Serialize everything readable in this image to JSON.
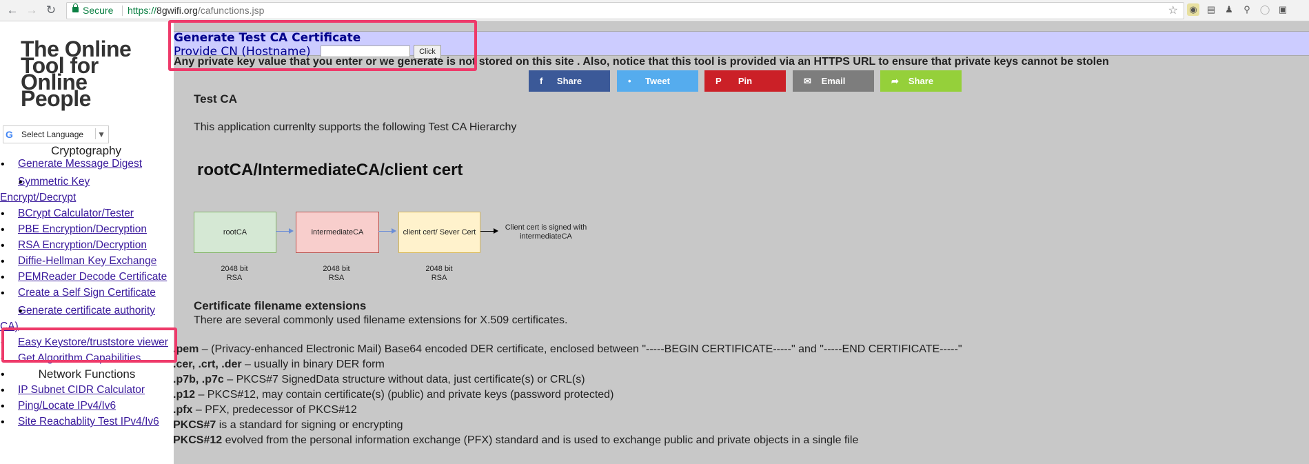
{
  "browser": {
    "secure_label": "Secure",
    "url_protocol": "https://",
    "url_host": "8gwifi.org",
    "url_path": "/cafunctions.jsp"
  },
  "sidebar": {
    "logo_lines": [
      "The Online",
      "Tool for",
      "Online",
      "People"
    ],
    "translate_label": "Select Language",
    "section_crypto": "Cryptography",
    "crypto_items": [
      "Generate Message Digest",
      "Symmetric Key",
      "Encrypt/Decrypt",
      "BCrypt Calculator/Tester",
      "PBE Encryption/Decryption",
      "RSA Encryption/Decryption",
      "Diffie-Hellman Key Exchange",
      "PEMReader Decode Certificate",
      "Create a Self Sign Certificate",
      "Generate certificate authority",
      "CA)",
      "Easy Keystore/truststore viewer",
      "Get Algorithm Capabilities"
    ],
    "section_network": "Network Functions",
    "network_items": [
      "IP Subnet CIDR Calculator",
      "Ping/Locate IPv4/Iv6",
      "Site Reachablity Test IPv4/Iv6"
    ]
  },
  "form": {
    "title": "Generate Test CA Certificate",
    "cn_label": "Provide CN (Hostname)",
    "cn_value": "",
    "click_label": "Click"
  },
  "warning": "Any private key value that you enter or we generate is not stored on this site . Also, notice that this tool is provided via an HTTPS URL to ensure that private keys cannot be stolen",
  "share_buttons": [
    {
      "label": "Share",
      "icon": "f",
      "color": "#3b5998"
    },
    {
      "label": "Tweet",
      "icon": "•",
      "color": "#55acee"
    },
    {
      "label": "Pin",
      "icon": "P",
      "color": "#cb2027"
    },
    {
      "label": "Email",
      "icon": "✉",
      "color": "#7d7d7d"
    },
    {
      "label": "Share",
      "icon": "➦",
      "color": "#95d03a"
    }
  ],
  "content": {
    "test_ca_heading": "Test CA",
    "support_text": "This application currenlty supports the following Test CA Hierarchy",
    "hierarchy_title": "rootCA/IntermediateCA/client cert",
    "diagram": {
      "boxes": [
        "rootCA",
        "intermediateCA",
        "client cert/ Sever Cert"
      ],
      "note_line1": "Client cert is signed with",
      "note_line2": "intermediateCA",
      "key_line1": "2048 bit",
      "key_line2": "RSA"
    },
    "ext_heading": "Certificate filename extensions",
    "ext_intro": "There are several commonly used filename extensions for X.509 certificates.",
    "extensions": [
      {
        "term": ".pem",
        "desc": " – (Privacy-enhanced Electronic Mail) Base64 encoded DER certificate, enclosed between \"-----BEGIN CERTIFICATE-----\" and \"-----END CERTIFICATE-----\""
      },
      {
        "term": ".cer, .crt, .der",
        "desc": " – usually in binary DER form"
      },
      {
        "term": ".p7b, .p7c",
        "desc": " – PKCS#7 SignedData structure without data, just certificate(s) or CRL(s)"
      },
      {
        "term": ".p12",
        "desc": " – PKCS#12, may contain certificate(s) (public) and private keys (password protected)"
      },
      {
        "term": ".pfx",
        "desc": " – PFX, predecessor of PKCS#12"
      },
      {
        "term": "PKCS#7",
        "desc": " is a standard for signing or encrypting"
      },
      {
        "term": "PKCS#12",
        "desc": " evolved from the personal information exchange (PFX) standard and is used to exchange public and private objects in a single file"
      }
    ]
  },
  "highlight_color": "#ee3a6a"
}
